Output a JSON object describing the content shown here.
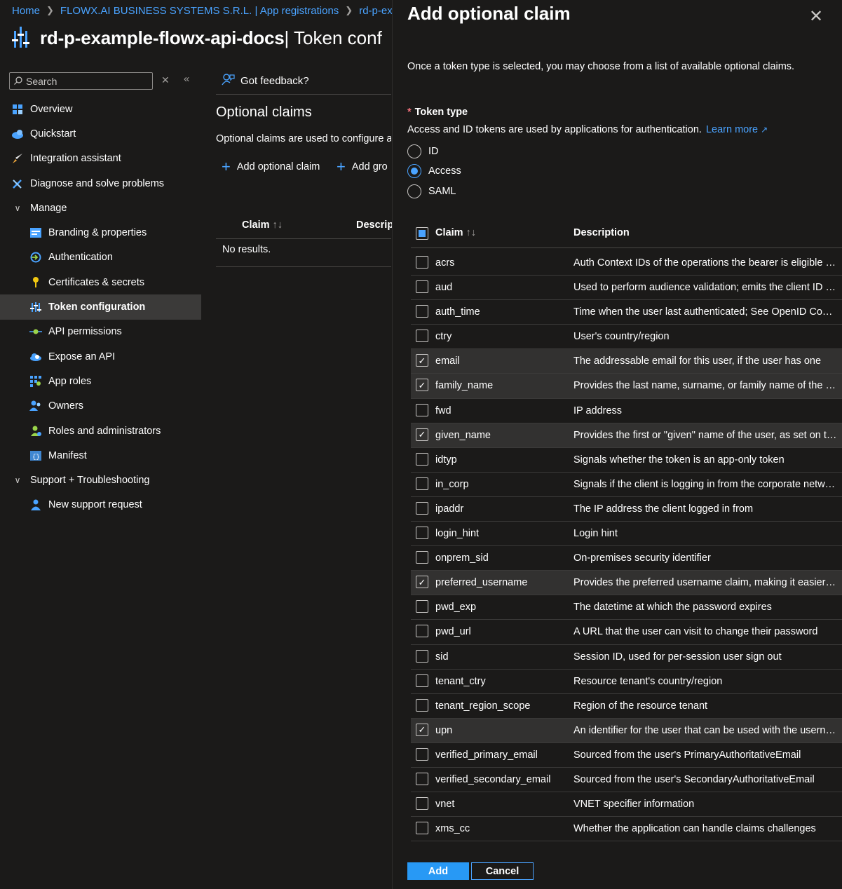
{
  "breadcrumb": {
    "items": [
      "Home",
      "FLOWX.AI BUSINESS SYSTEMS S.R.L. | App registrations",
      "rd-p-examp"
    ]
  },
  "header": {
    "title": "rd-p-example-flowx-api-docs",
    "subtitle": " | Token conf"
  },
  "sidebar": {
    "search_placeholder": "Search",
    "items": [
      {
        "label": "Overview",
        "icon": "overview-icon"
      },
      {
        "label": "Quickstart",
        "icon": "quickstart-icon"
      },
      {
        "label": "Integration assistant",
        "icon": "rocket-icon"
      },
      {
        "label": "Diagnose and solve problems",
        "icon": "wrench-icon"
      },
      {
        "label": "Manage",
        "icon": "chevron-down-icon"
      },
      {
        "label": "Branding & properties",
        "icon": "branding-icon"
      },
      {
        "label": "Authentication",
        "icon": "authentication-icon"
      },
      {
        "label": "Certificates & secrets",
        "icon": "key-icon"
      },
      {
        "label": "Token configuration",
        "icon": "token-icon"
      },
      {
        "label": "API permissions",
        "icon": "api-permissions-icon"
      },
      {
        "label": "Expose an API",
        "icon": "cloud-icon"
      },
      {
        "label": "App roles",
        "icon": "app-roles-icon"
      },
      {
        "label": "Owners",
        "icon": "owners-icon"
      },
      {
        "label": "Roles and administrators",
        "icon": "roles-icon"
      },
      {
        "label": "Manifest",
        "icon": "manifest-icon"
      },
      {
        "label": "Support + Troubleshooting",
        "icon": "chevron-down-icon"
      },
      {
        "label": "New support request",
        "icon": "support-person-icon"
      }
    ]
  },
  "main": {
    "feedback_label": "Got feedback?",
    "section_title": "Optional claims",
    "section_desc": "Optional claims are used to configure ac",
    "add_optional_claim": "Add optional claim",
    "add_groups_claim": "Add gro",
    "col_claim": "Claim",
    "col_description": "Descrip",
    "no_results": "No results."
  },
  "panel": {
    "title": "Add optional claim",
    "intro": "Once a token type is selected, you may choose from a list of available optional claims.",
    "token_type_label": "Token type",
    "required_mark": "*",
    "token_type_desc": "Access and ID tokens are used by applications for authentication.",
    "learn_more": "Learn more",
    "radios": [
      {
        "label": "ID",
        "selected": false
      },
      {
        "label": "Access",
        "selected": true
      },
      {
        "label": "SAML",
        "selected": false
      }
    ],
    "col_claim": "Claim",
    "col_description": "Description",
    "claims": [
      {
        "name": "acrs",
        "desc": "Auth Context IDs of the operations the bearer is eligible t…",
        "checked": false
      },
      {
        "name": "aud",
        "desc": "Used to perform audience validation; emits the client ID o…",
        "checked": false
      },
      {
        "name": "auth_time",
        "desc": "Time when the user last authenticated; See OpenID Conn…",
        "checked": false
      },
      {
        "name": "ctry",
        "desc": "User's country/region",
        "checked": false
      },
      {
        "name": "email",
        "desc": "The addressable email for this user, if the user has one",
        "checked": true
      },
      {
        "name": "family_name",
        "desc": "Provides the last name, surname, or family name of the us…",
        "checked": true
      },
      {
        "name": "fwd",
        "desc": "IP address",
        "checked": false
      },
      {
        "name": "given_name",
        "desc": "Provides the first or \"given\" name of the user, as set on th…",
        "checked": true
      },
      {
        "name": "idtyp",
        "desc": "Signals whether the token is an app-only token",
        "checked": false
      },
      {
        "name": "in_corp",
        "desc": "Signals if the client is logging in from the corporate netw…",
        "checked": false
      },
      {
        "name": "ipaddr",
        "desc": "The IP address the client logged in from",
        "checked": false
      },
      {
        "name": "login_hint",
        "desc": "Login hint",
        "checked": false
      },
      {
        "name": "onprem_sid",
        "desc": "On-premises security identifier",
        "checked": false
      },
      {
        "name": "preferred_username",
        "desc": "Provides the preferred username claim, making it easier f…",
        "checked": true
      },
      {
        "name": "pwd_exp",
        "desc": "The datetime at which the password expires",
        "checked": false
      },
      {
        "name": "pwd_url",
        "desc": "A URL that the user can visit to change their password",
        "checked": false
      },
      {
        "name": "sid",
        "desc": "Session ID, used for per-session user sign out",
        "checked": false
      },
      {
        "name": "tenant_ctry",
        "desc": "Resource tenant's country/region",
        "checked": false
      },
      {
        "name": "tenant_region_scope",
        "desc": "Region of the resource tenant",
        "checked": false
      },
      {
        "name": "upn",
        "desc": "An identifier for the user that can be used with the userna…",
        "checked": true
      },
      {
        "name": "verified_primary_email",
        "desc": "Sourced from the user's PrimaryAuthoritativeEmail",
        "checked": false
      },
      {
        "name": "verified_secondary_email",
        "desc": "Sourced from the user's SecondaryAuthoritativeEmail",
        "checked": false
      },
      {
        "name": "vnet",
        "desc": "VNET specifier information",
        "checked": false
      },
      {
        "name": "xms_cc",
        "desc": "Whether the application can handle claims challenges",
        "checked": false
      }
    ],
    "add_button": "Add",
    "cancel_button": "Cancel"
  },
  "colors": {
    "background": "#1b1a19",
    "accent": "#4aa3ff",
    "primary_button": "#2899f5",
    "selected_row": "#323130",
    "active_nav": "#3b3a39"
  }
}
